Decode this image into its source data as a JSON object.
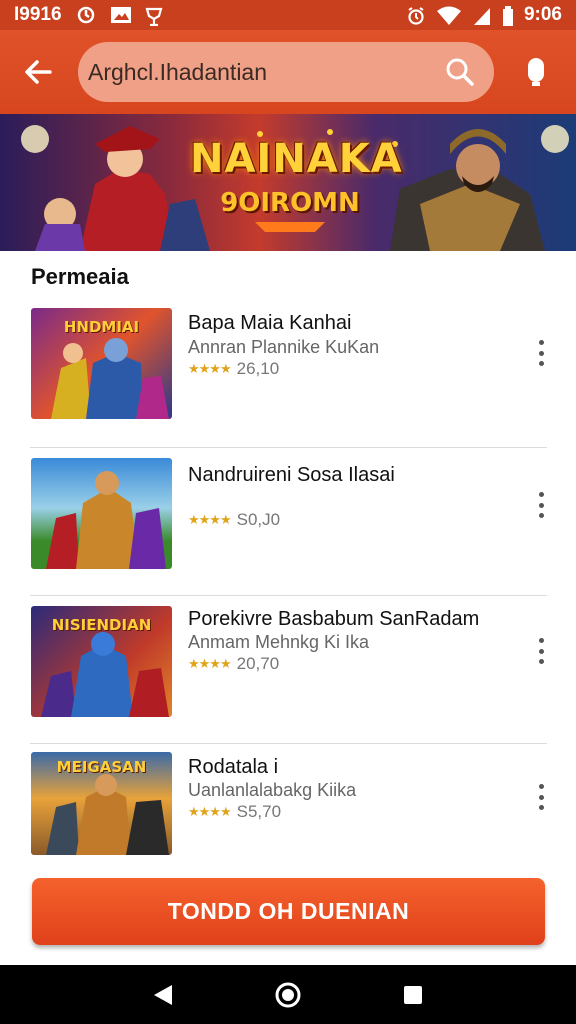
{
  "status_bar": {
    "left_text": "I9916",
    "time": "9:06",
    "icons": [
      "sync-icon",
      "photo-icon",
      "shield-icon",
      "alarm-icon",
      "wifi-icon",
      "signal-icon",
      "battery-icon"
    ]
  },
  "app_bar": {
    "search_value": "Arghcl.Ihadantian",
    "icons": [
      "back-arrow-icon",
      "search-icon",
      "mic-icon"
    ]
  },
  "banner": {
    "title": "NAINAKA",
    "subtitle": "9OIROMN"
  },
  "section": {
    "title": "Permeaia"
  },
  "items": [
    {
      "thumb_title": "HNDMIAI",
      "title": "Bapa Maia Kanhai",
      "subtitle": "Annran Plannike KuKan",
      "rating": "26,10",
      "stars": "★★★★"
    },
    {
      "thumb_title": "",
      "title": "Nandruireni Sosa Ilasai",
      "subtitle": "",
      "rating": "S0,J0",
      "stars": "★★★★"
    },
    {
      "thumb_title": "NISIENDIAN",
      "title": "Porekivre Basbabum SanRadam",
      "subtitle": "Anmam Mehnkg Ki Ika",
      "rating": "20,70",
      "stars": "★★★★"
    },
    {
      "thumb_title": "MEIGASAN",
      "title": "Rodatala i",
      "subtitle": "Uanlanlalabakg Kiika",
      "rating": "S5,70",
      "stars": "★★★★"
    }
  ],
  "cta": {
    "label": "TONDD OH DUENIAN"
  },
  "nav_bar": {
    "icons": [
      "back-triangle-icon",
      "home-circle-icon",
      "recents-square-icon"
    ]
  },
  "colors": {
    "accent": "#d7461f",
    "cta": "#ef5424",
    "star": "#e0a41c"
  }
}
